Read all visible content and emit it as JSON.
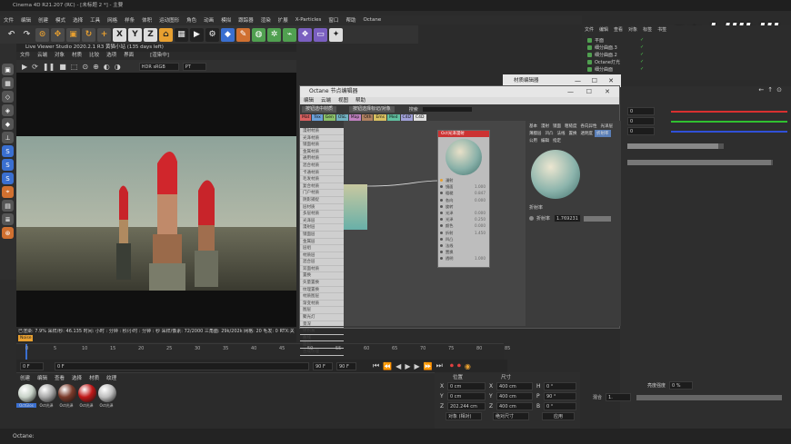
{
  "app_title": "Cinema 4D R21.207 (RC) - [未标题 2 *] - 主要",
  "main_menu": [
    "文件",
    "编辑",
    "创建",
    "模式",
    "选择",
    "工具",
    "网格",
    "样条",
    "体积",
    "运动图形",
    "角色",
    "动画",
    "模拟",
    "跟踪器",
    "渲染",
    "扩展",
    "X-Particles",
    "窗口",
    "帮助",
    "Octane"
  ],
  "toolbar_icons": [
    "undo-icon",
    "redo-icon",
    "move-icon",
    "scale-icon",
    "rotate-icon",
    "x-axis-icon",
    "y-axis-icon",
    "z-axis-icon",
    "coord-icon",
    "render-icon"
  ],
  "axis_labels": [
    "X",
    "Y",
    "Z"
  ],
  "live_viewer": {
    "title": "Live Viewer Studio 2020.2.1 R3 黄猫小站 (135 days left)",
    "menu": [
      "文件",
      "云端",
      "对象",
      "材质",
      "比较",
      "选项",
      "界面"
    ],
    "menu_extra": "[渲染中]",
    "color_space": "HDR sRGB",
    "mode": "PT",
    "status_line1": "已渲染: 7.9%   采样/秒: 46.135   时间: 小时 : 分钟 : 秒/小时 : 分钟 : 秒   采样/像素: 72/2000   三角面: 29k/202k   网格: 20   毛发: 0   RTX:关",
    "status_line2": "Noise"
  },
  "timeline": {
    "ticks": [
      "0",
      "5",
      "10",
      "15",
      "20",
      "25",
      "30",
      "35",
      "40",
      "45",
      "50",
      "55",
      "60",
      "65",
      "70",
      "75",
      "80",
      "85"
    ],
    "start_field": "0 F",
    "current_field": "0 F",
    "end_field": "90 F",
    "end_field2": "90 F"
  },
  "material_panel": {
    "menu": [
      "创建",
      "编辑",
      "查看",
      "选择",
      "材质",
      "纹理"
    ],
    "materials": [
      {
        "name": "OctGlos",
        "color": "#c8d2c8"
      },
      {
        "name": "Oct光泽",
        "color": "#a8a8a8"
      },
      {
        "name": "Oct光泽",
        "color": "#7a3a2a"
      },
      {
        "name": "Oct光泽",
        "color": "#c01818"
      },
      {
        "name": "Oct光泽",
        "color": "#bdbdbd"
      }
    ]
  },
  "coords": {
    "header_left": "位置",
    "header_right": "尺寸",
    "header_rot": "旋转",
    "rows": [
      {
        "axis": "X",
        "pos": "0 cm",
        "size": "400 cm",
        "rot_axis": "H",
        "rot": "0 °"
      },
      {
        "axis": "Y",
        "pos": "0 cm",
        "size": "400 cm",
        "rot_axis": "P",
        "rot": "90 °"
      },
      {
        "axis": "Z",
        "pos": "202.244 cm",
        "size": "400 cm",
        "rot_axis": "B",
        "rot": "0 °"
      }
    ],
    "mode_left": "对象 (相对)",
    "mode_right": "绝对尺寸",
    "apply": "应用"
  },
  "object_manager": {
    "menu": [
      "文件",
      "编辑",
      "查看",
      "对象",
      "标签",
      "书签"
    ],
    "items": [
      "平面",
      "细分曲面.3",
      "细分曲面.2",
      "Octane灯光",
      "细分曲面"
    ]
  },
  "watermark": "Jidu几度",
  "watermark2": "bilibili",
  "node_editor": {
    "title": "Octane 节点编辑器",
    "menu": [
      "编辑",
      "云端",
      "视图",
      "帮助"
    ],
    "btn_left": "按钮选中材质",
    "btn_mid": "按钮选择标记/对象",
    "btn_search": "搜索",
    "categories": [
      {
        "label": "Mat",
        "color": "#d86060"
      },
      {
        "label": "Tex",
        "color": "#6a9fd8"
      },
      {
        "label": "Gen",
        "color": "#8ac06a"
      },
      {
        "label": "OSL",
        "color": "#70b0c0"
      },
      {
        "label": "Map",
        "color": "#c080c0"
      },
      {
        "label": "Oth",
        "color": "#b08060"
      },
      {
        "label": "Ems",
        "color": "#d8c060"
      },
      {
        "label": "Med",
        "color": "#60c0a0"
      },
      {
        "label": "C4D",
        "color": "#a0a0d8"
      },
      {
        "label": "C4D",
        "color": "#e0e0e0"
      }
    ],
    "node_list": [
      "漫射材质",
      "光泽材质",
      "镜面材质",
      "金属材质",
      "通用材质",
      "混合材质",
      "卡通材质",
      "毛发材质",
      "复合材质",
      "门户材质",
      "阴影捕捉",
      "层材质",
      "多层材质",
      "光泽层",
      "漫射层",
      "镜面层",
      "金属层",
      "层组",
      "材质层",
      "混合层",
      "双面材质",
      "置换",
      "矢量置换",
      "纹理置换",
      "材质图层",
      "渐变材质",
      "图层",
      "聚光灯",
      "景深",
      "体积雾",
      "曲线",
      "面料",
      "合成纹理"
    ],
    "node": {
      "title": "Oct光泽漫射",
      "rows": [
        {
          "label": "漫射",
          "value": ""
        },
        {
          "label": "镜面",
          "value": "1.000"
        },
        {
          "label": "粗糙",
          "value": "0.847"
        },
        {
          "label": "各向",
          "value": "0.000"
        },
        {
          "label": "旋转",
          "value": ""
        },
        {
          "label": "光泽",
          "value": "0.000"
        },
        {
          "label": "光泽",
          "value": "0.250"
        },
        {
          "label": "颜色",
          "value": "0.000"
        },
        {
          "label": "折射",
          "value": "1.450"
        },
        {
          "label": "凹凸",
          "value": ""
        },
        {
          "label": "法线",
          "value": ""
        },
        {
          "label": "置换",
          "value": ""
        },
        {
          "label": "透明",
          "value": "1.000"
        }
      ]
    },
    "props_tabs": [
      "基本",
      "漫射",
      "镜面",
      "粗糙度",
      "各向异性",
      "光泽层",
      "薄膜层",
      "凹凸",
      "法线",
      "置换",
      "透明度",
      "折射率",
      "公用",
      "编辑",
      "指定"
    ],
    "active_tab": "折射率",
    "props_label": "折射率",
    "props_field_label": "折射率",
    "props_value": "1.769231"
  },
  "material_editor": {
    "title": "材质编辑器"
  },
  "attr_rows": [
    {
      "label": "",
      "value": "0",
      "color": "#d83030"
    },
    {
      "label": "",
      "value": "0",
      "color": "#30c030"
    },
    {
      "label": "",
      "value": "0",
      "color": "#3050d8"
    }
  ],
  "attr_bottom": {
    "label": "亮度强度",
    "value": "0 %",
    "label2": "混合",
    "value2": "1."
  },
  "statusbar_text": "Octane:"
}
